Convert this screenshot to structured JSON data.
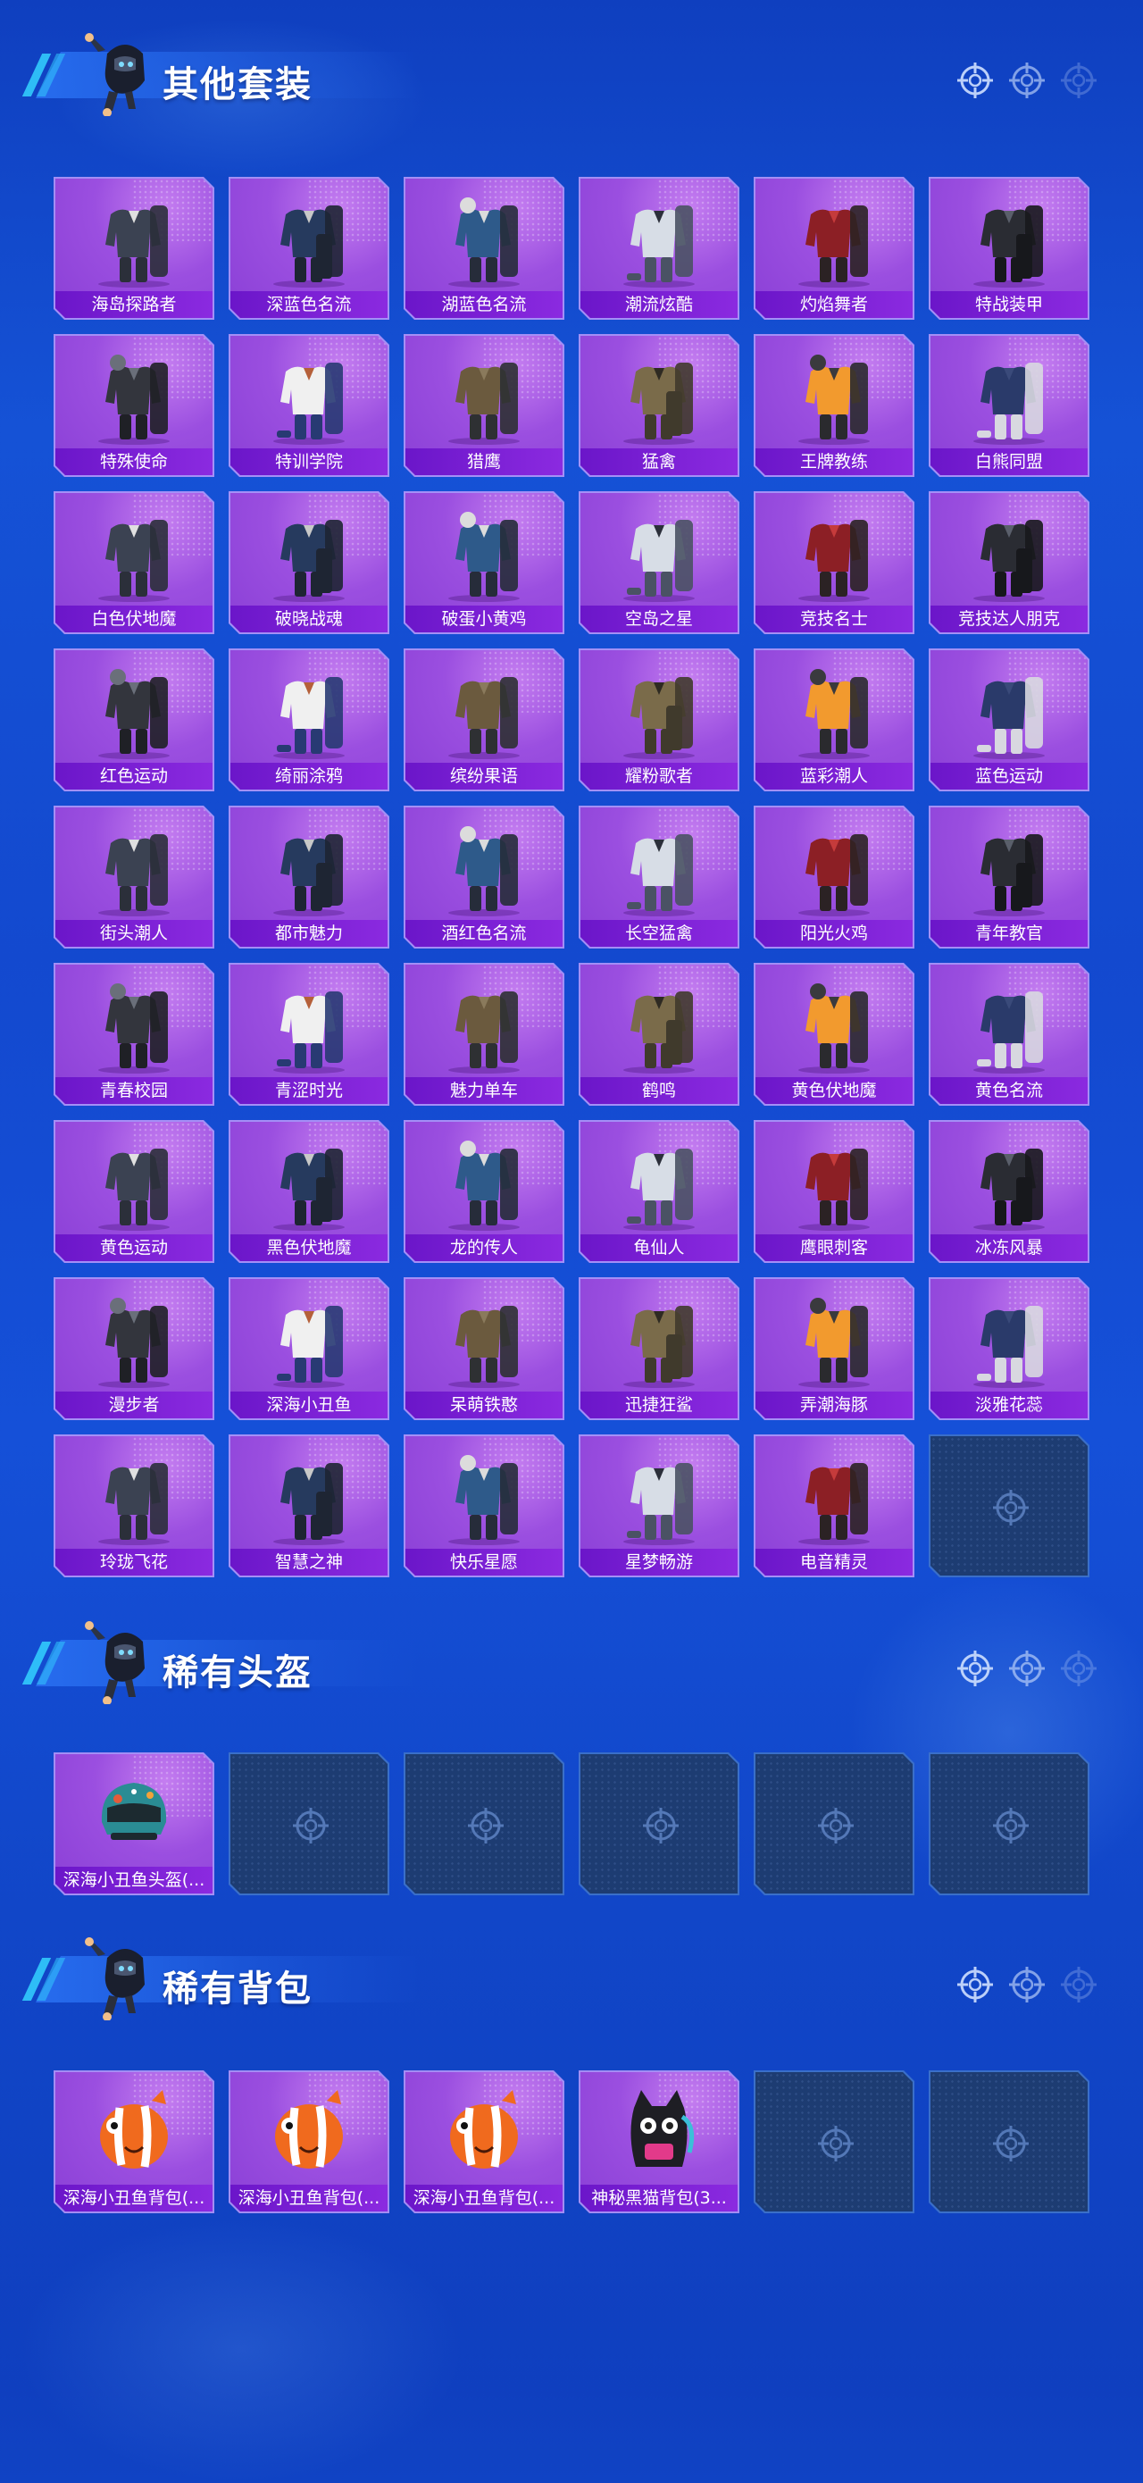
{
  "sections": [
    {
      "title": "其他套装",
      "items": [
        "海岛探路者",
        "深蓝色名流",
        "湖蓝色名流",
        "潮流炫酷",
        "灼焰舞者",
        "特战装甲",
        "特殊使命",
        "特训学院",
        "猎鹰",
        "猛禽",
        "王牌教练",
        "白熊同盟",
        "白色伏地魔",
        "破晓战魂",
        "破蛋小黄鸡",
        "空岛之星",
        "竞技名士",
        "竞技达人朋克",
        "红色运动",
        "绮丽涂鸦",
        "缤纷果语",
        "耀粉歌者",
        "蓝彩潮人",
        "蓝色运动",
        "街头潮人",
        "都市魅力",
        "酒红色名流",
        "长空猛禽",
        "阳光火鸡",
        "青年教官",
        "青春校园",
        "青涩时光",
        "魅力单车",
        "鹤鸣",
        "黄色伏地魔",
        "黄色名流",
        "黄色运动",
        "黑色伏地魔",
        "龙的传人",
        "龟仙人",
        "鹰眼刺客",
        "冰冻风暴",
        "漫步者",
        "深海小丑鱼",
        "呆萌铁憨",
        "迅捷狂鲨",
        "弄潮海豚",
        "淡雅花蕊",
        "玲珑飞花",
        "智慧之神",
        "快乐星愿",
        "星梦畅游",
        "电音精灵"
      ],
      "empty_slots": 1
    },
    {
      "title": "稀有头盔",
      "items": [
        "深海小丑鱼头盔(..."
      ],
      "empty_slots": 5
    },
    {
      "title": "稀有背包",
      "items": [
        "深海小丑鱼背包(...",
        "深海小丑鱼背包(...",
        "深海小丑鱼背包(...",
        "神秘黑猫背包(3..."
      ],
      "empty_slots": 2
    }
  ],
  "icons": {
    "header_decoration": "crosshair-icon",
    "empty_slot": "crosshair-icon",
    "mascot": "mascot-icon"
  },
  "colors": {
    "background": "#1552d6",
    "card": "#9b4fe0",
    "label_bar": "#6b16c9",
    "empty_slot": "#1d3c72"
  }
}
